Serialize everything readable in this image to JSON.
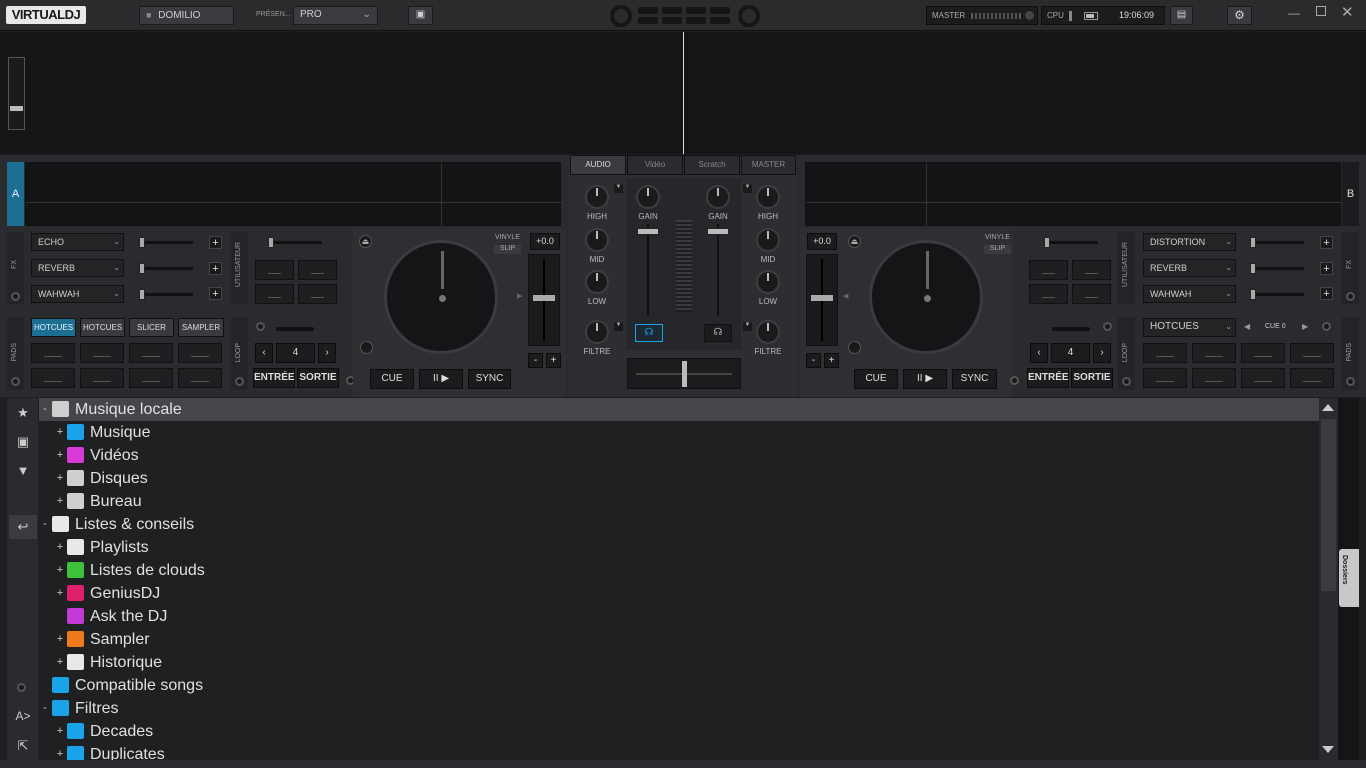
{
  "app": {
    "logo": "VIRTUALDJ",
    "user": "DOMILIO",
    "preset_label": "PRÉSEN...",
    "preset_value": "PRO",
    "master_label": "MASTER",
    "cpu_label": "CPU",
    "clock": "19:06:09"
  },
  "deck_a": {
    "letter": "A",
    "fx_side_label": "FX",
    "fx": [
      "ECHO",
      "REVERB",
      "WAHWAH"
    ],
    "user_label": "UTILISATEUR",
    "pad_side_label": "PADS",
    "pad_tabs": [
      "HOTCUES",
      "HOTCUES",
      "SLICER",
      "SAMPLER"
    ],
    "loop_label": "LOOP",
    "loop_value": "4",
    "loop_in": "ENTRÉE",
    "loop_out": "SORTIE",
    "vinyl": "VINYLE",
    "slip": "SLIP",
    "pitch": "+0.0",
    "pitch_minus": "-",
    "pitch_plus": "+",
    "cue": "CUE",
    "play": "II ▶",
    "sync": "SYNC"
  },
  "deck_b": {
    "letter": "B",
    "fx_side_label": "FX",
    "fx": [
      "DISTORTION",
      "REVERB",
      "WAHWAH"
    ],
    "user_label": "UTILISATEUR",
    "pad_side_label": "PADS",
    "pad_mode": "HOTCUES",
    "cue_label": "CUE 0",
    "loop_label": "LOOP",
    "loop_value": "4",
    "loop_in": "ENTRÉE",
    "loop_out": "SORTIE",
    "vinyl": "VINYLE",
    "slip": "SLIP",
    "pitch": "+0.0",
    "pitch_minus": "-",
    "pitch_plus": "+",
    "cue": "CUE",
    "play": "II ▶",
    "sync": "SYNC"
  },
  "mixer": {
    "tabs": [
      "AUDIO",
      "Vidéo",
      "Scratch",
      "MASTER"
    ],
    "high": "HIGH",
    "mid": "MID",
    "low": "LOW",
    "gain": "GAIN",
    "filter": "FILTRE"
  },
  "browser": {
    "folders_tab": "Dossiers",
    "tree": [
      {
        "label": "Musique locale",
        "level": 0,
        "expander": "-",
        "icon": "monitor-icon",
        "color": "#cfcfcf",
        "selected": true
      },
      {
        "label": "Musique",
        "level": 1,
        "expander": "+",
        "icon": "music-note-icon",
        "color": "#1aa3e8"
      },
      {
        "label": "Vidéos",
        "level": 1,
        "expander": "+",
        "icon": "film-icon",
        "color": "#d93ad6"
      },
      {
        "label": "Disques",
        "level": 1,
        "expander": "+",
        "icon": "computer-icon",
        "color": "#cfcfcf"
      },
      {
        "label": "Bureau",
        "level": 1,
        "expander": "+",
        "icon": "desktop-icon",
        "color": "#cfcfcf"
      },
      {
        "label": "Listes & conseils",
        "level": 0,
        "expander": "-",
        "icon": "list-icon",
        "color": "#e8e8e8"
      },
      {
        "label": "Playlists",
        "level": 1,
        "expander": "+",
        "icon": "playlist-icon",
        "color": "#e8e8e8"
      },
      {
        "label": "Listes de clouds",
        "level": 1,
        "expander": "+",
        "icon": "cloud-icon",
        "color": "#3cc13c"
      },
      {
        "label": "GeniusDJ",
        "level": 1,
        "expander": "+",
        "icon": "genius-icon",
        "color": "#e0206a"
      },
      {
        "label": "Ask the DJ",
        "level": 1,
        "expander": "",
        "icon": "chat-icon",
        "color": "#c43ad6"
      },
      {
        "label": "Sampler",
        "level": 1,
        "expander": "+",
        "icon": "sampler-grid-icon",
        "color": "#ee7a1a"
      },
      {
        "label": "Historique",
        "level": 1,
        "expander": "+",
        "icon": "calendar-icon",
        "color": "#e8e8e8"
      },
      {
        "label": "Compatible songs",
        "level": 0,
        "expander": "",
        "icon": "search-folder-icon",
        "color": "#1aa3e8"
      },
      {
        "label": "Filtres",
        "level": 0,
        "expander": "-",
        "icon": "search-folder-icon",
        "color": "#1aa3e8"
      },
      {
        "label": "Decades",
        "level": 1,
        "expander": "+",
        "icon": "search-folder-icon",
        "color": "#1aa3e8"
      },
      {
        "label": "Duplicates",
        "level": 1,
        "expander": "+",
        "icon": "search-folder-icon",
        "color": "#1aa3e8"
      }
    ]
  },
  "colors": {
    "accent": "#1aa3e8",
    "background": "#1e1f21",
    "panel": "#2c2d30"
  }
}
